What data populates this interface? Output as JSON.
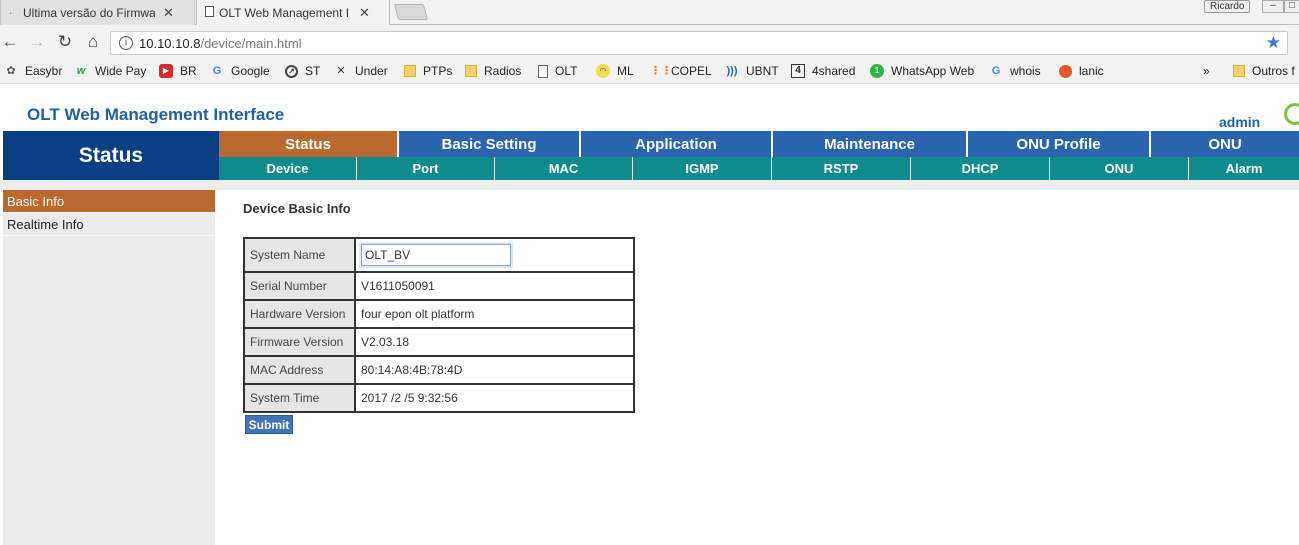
{
  "browser": {
    "tabs": [
      {
        "label": "Ultima versão do Firmwa",
        "active": false
      },
      {
        "label": "OLT Web Management I",
        "active": true
      }
    ],
    "user_badge": "Ricardo",
    "url_host": "10.10.10.8",
    "url_path": "/device/main.html",
    "bookmarks": [
      {
        "label": "Easybr",
        "icon": "easybr-icon"
      },
      {
        "label": "Wide Pay",
        "icon": "widepay-icon"
      },
      {
        "label": "BR",
        "icon": "youtube-icon"
      },
      {
        "label": "Google",
        "icon": "google-icon"
      },
      {
        "label": "ST",
        "icon": "speedometer-icon"
      },
      {
        "label": "Under",
        "icon": "under-icon"
      },
      {
        "label": "PTPs",
        "icon": "folder-icon"
      },
      {
        "label": "Radios",
        "icon": "folder-icon"
      },
      {
        "label": "OLT",
        "icon": "page-icon"
      },
      {
        "label": "ML",
        "icon": "mercadolivre-icon"
      },
      {
        "label": "COPEL",
        "icon": "copel-icon"
      },
      {
        "label": "UBNT",
        "icon": "rss-icon"
      },
      {
        "label": "4shared",
        "icon": "4shared-icon"
      },
      {
        "label": "WhatsApp Web",
        "icon": "whatsapp-icon"
      },
      {
        "label": "whois",
        "icon": "google-icon"
      },
      {
        "label": "lanic",
        "icon": "lanic-icon"
      }
    ],
    "overflow": "»",
    "other_bookmarks": "Outros f"
  },
  "app": {
    "title": "OLT Web Management Interface",
    "user": "admin",
    "section": "Status",
    "main_menu": [
      "Status",
      "Basic Setting",
      "Application",
      "Maintenance",
      "ONU Profile",
      "ONU"
    ],
    "sub_menu": [
      "Device",
      "Port",
      "MAC",
      "IGMP",
      "RSTP",
      "DHCP",
      "ONU",
      "Alarm"
    ],
    "sidebar": [
      "Basic Info",
      "Realtime Info"
    ],
    "content_title": "Device Basic Info",
    "rows": [
      {
        "label": "System Name",
        "value": "OLT_BV"
      },
      {
        "label": "Serial Number",
        "value": "V1611050091"
      },
      {
        "label": "Hardware Version",
        "value": "four epon olt platform"
      },
      {
        "label": "Firmware Version",
        "value": "V2.03.18"
      },
      {
        "label": "MAC Address",
        "value": "80:14:A8:4B:78:4D"
      },
      {
        "label": "System Time",
        "value": "2017 /2 /5 9:32:56"
      }
    ],
    "submit_label": "Submit"
  },
  "colors": {
    "header_blue": "#0a3f83",
    "menu_blue": "#2a64ad",
    "active_orange": "#b9692e",
    "submenu_teal": "#0f8a8d",
    "title_blue": "#1f5fa8"
  }
}
